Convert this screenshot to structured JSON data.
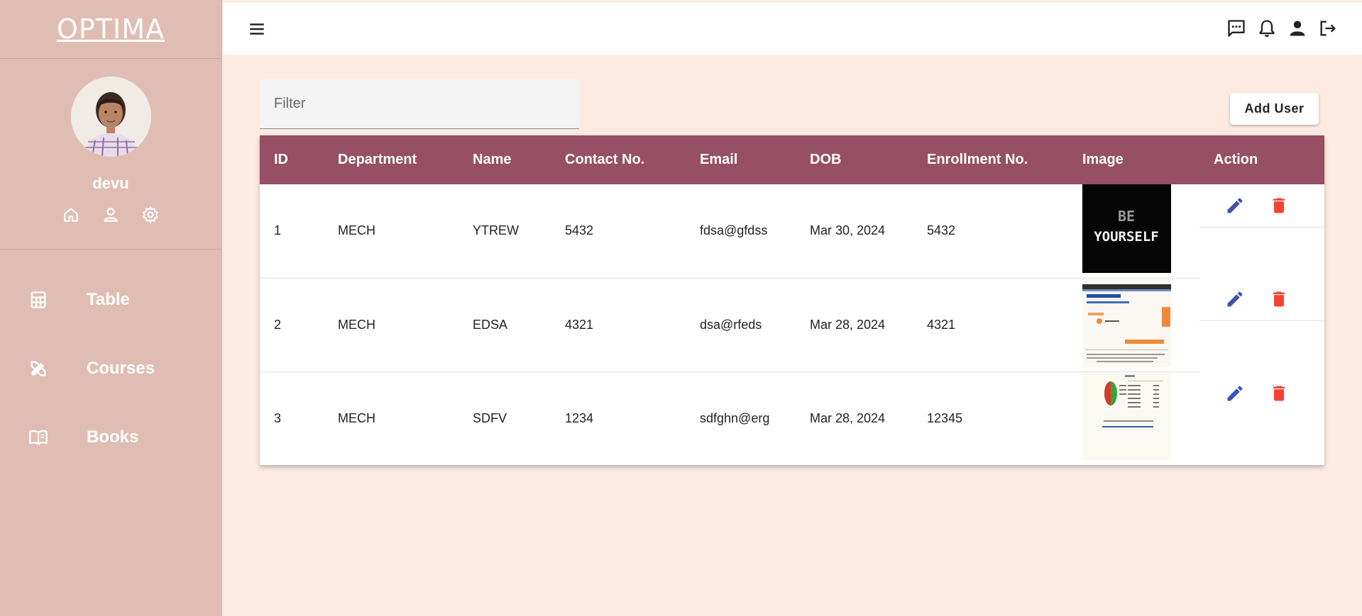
{
  "app": {
    "brand": "OPTIMA"
  },
  "profile": {
    "username": "devu"
  },
  "sidebar": {
    "items": [
      {
        "label": "Table",
        "icon": "calculator-icon"
      },
      {
        "label": "Courses",
        "icon": "design-tools-icon"
      },
      {
        "label": "Books",
        "icon": "book-icon"
      }
    ]
  },
  "toolbar": {
    "filter_placeholder": "Filter",
    "add_user_label": "Add User"
  },
  "table": {
    "columns": [
      "ID",
      "Department",
      "Name",
      "Contact No.",
      "Email",
      "DOB",
      "Enrollment No.",
      "Image",
      "Action"
    ],
    "rows": [
      {
        "id": "1",
        "department": "MECH",
        "name": "YTREW",
        "contact": "5432",
        "email": "fdsa@gfdss",
        "dob": "Mar 30, 2024",
        "enrollment": "5432"
      },
      {
        "id": "2",
        "department": "MECH",
        "name": "EDSA",
        "contact": "4321",
        "email": "dsa@rfeds",
        "dob": "Mar 28, 2024",
        "enrollment": "4321"
      },
      {
        "id": "3",
        "department": "MECH",
        "name": "SDFV",
        "contact": "1234",
        "email": "sdfghn@erg",
        "dob": "Mar 28, 2024",
        "enrollment": "12345"
      }
    ]
  },
  "thumb1_text": [
    "BE",
    "YOURSELF"
  ],
  "colors": {
    "sidebar": "#e0bdb2",
    "background": "#fdebe2",
    "table_header": "#964f65",
    "edit": "#3f51b5",
    "delete": "#f44336"
  }
}
